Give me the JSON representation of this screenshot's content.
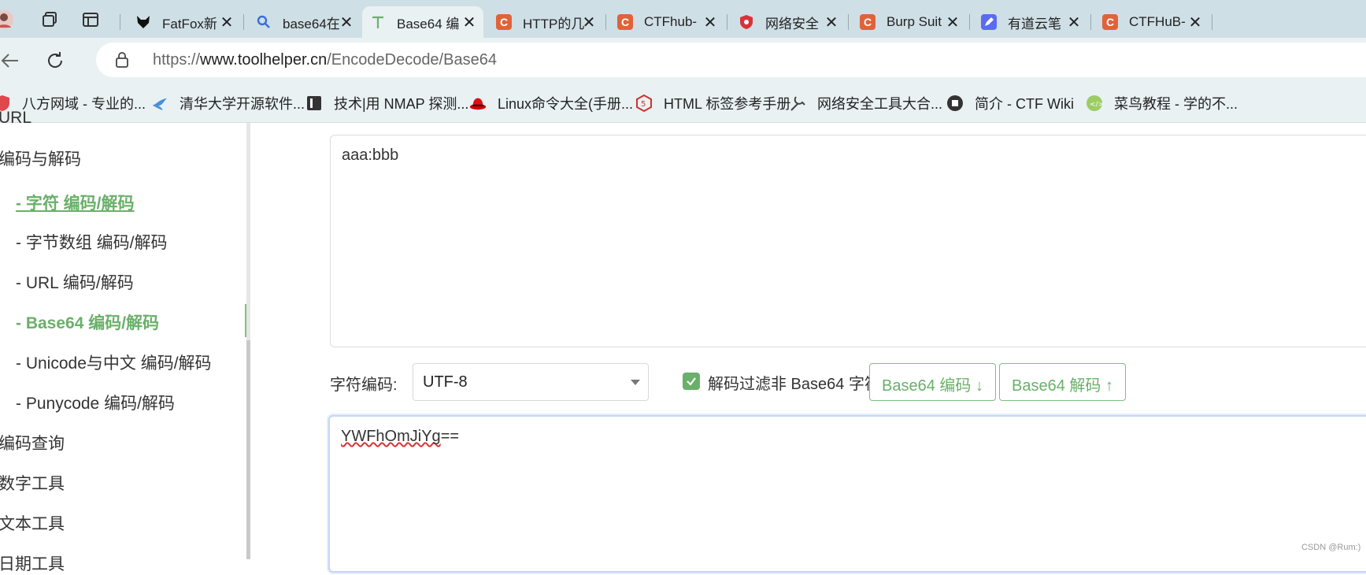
{
  "browser": {
    "tabs": [
      {
        "title": "FatFox新",
        "favicon": "fox-icon",
        "color": "#111111"
      },
      {
        "title": "base64在",
        "favicon": "search-icon",
        "color": "#3a6fd8"
      },
      {
        "title": "Base64 编",
        "favicon": "toolhelper-icon",
        "color": "#6ab06a",
        "active": true
      },
      {
        "title": "HTTP的几",
        "favicon": "c-icon",
        "color": "#e0623b"
      },
      {
        "title": "CTFhub-",
        "favicon": "c-icon",
        "color": "#e0623b"
      },
      {
        "title": "网络安全",
        "favicon": "shield-icon",
        "color": "#d8333a"
      },
      {
        "title": "Burp Suit",
        "favicon": "c-icon",
        "color": "#e0623b"
      },
      {
        "title": "有道云笔",
        "favicon": "youdao-icon",
        "color": "#5b6cf0"
      },
      {
        "title": "CTFHuB-",
        "favicon": "c-icon",
        "color": "#e0623b"
      }
    ],
    "close_glyph": "✕",
    "address": {
      "prefix": "https://",
      "domain": "www.toolhelper.cn",
      "path": "/EncodeDecode/Base64"
    }
  },
  "bookmarks": [
    {
      "label": "八方网域 - 专业的...",
      "icon": "shield-icon"
    },
    {
      "label": "清华大学开源软件...",
      "icon": "bird-icon"
    },
    {
      "label": "技术|用 NMAP 探测...",
      "icon": "book-icon"
    },
    {
      "label": "Linux命令大全(手册...",
      "icon": "redhat-icon"
    },
    {
      "label": "HTML 标签参考手册",
      "icon": "html-icon"
    },
    {
      "label": "网络安全工具大合...",
      "icon": "tool-icon"
    },
    {
      "label": "简介 - CTF Wiki",
      "icon": "ctfwiki-icon"
    },
    {
      "label": "菜鸟教程 - 学的不...",
      "icon": "runoob-icon"
    }
  ],
  "sidebar": {
    "top_partial": "URL",
    "items": [
      {
        "label": "编码与解码"
      },
      {
        "label": "- 字符  编码/解码"
      },
      {
        "label": "- 字节数组  编码/解码"
      },
      {
        "label": "- URL  编码/解码"
      },
      {
        "label": "- Base64  编码/解码"
      },
      {
        "label": "- Unicode与中文  编码/解码"
      },
      {
        "label": "- Punycode  编码/解码"
      },
      {
        "label": "编码查询"
      },
      {
        "label": "数字工具"
      },
      {
        "label": "文本工具"
      },
      {
        "label": "日期工具"
      }
    ]
  },
  "main": {
    "input_text": "aaa:bbb",
    "charset_label": "字符编码:",
    "charset_value": "UTF-8",
    "filter_label": "解码过滤非 Base64 字符",
    "filter_checked": true,
    "encode_button": "Base64 编码 ↓",
    "decode_button": "Base64 解码 ↑",
    "output_text": "YWFhOmJiYg",
    "output_tail": "=="
  },
  "watermark": "CSDN @Rum:)"
}
